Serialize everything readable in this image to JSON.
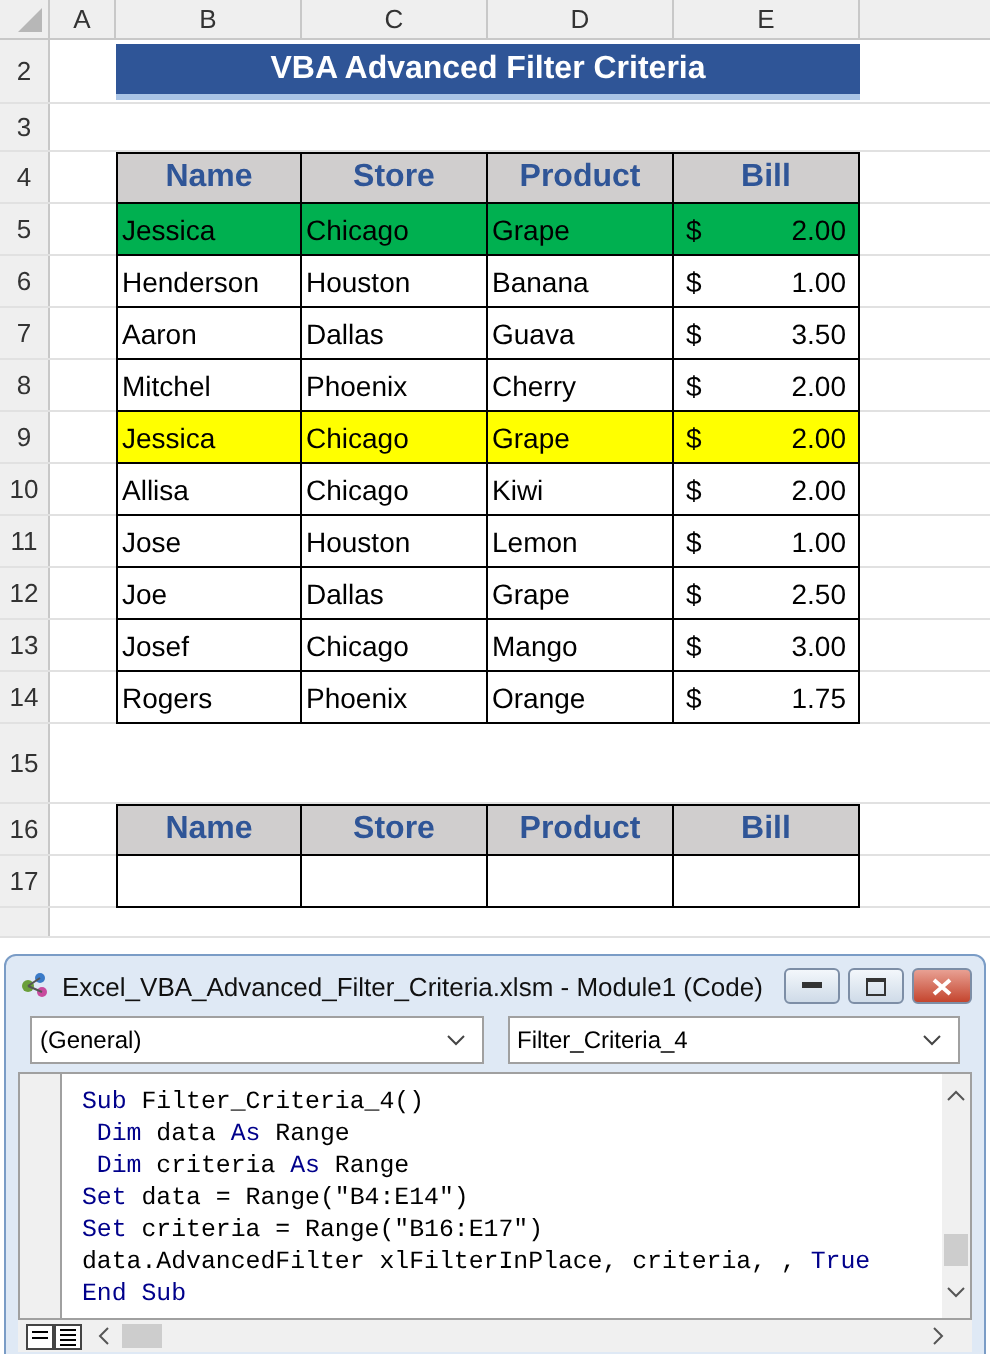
{
  "sheet": {
    "column_letters": [
      "A",
      "B",
      "C",
      "D",
      "E"
    ],
    "row_numbers": [
      "2",
      "3",
      "4",
      "5",
      "6",
      "7",
      "8",
      "9",
      "10",
      "11",
      "12",
      "13",
      "14",
      "15",
      "16",
      "17"
    ],
    "title": "VBA Advanced Filter Criteria",
    "table": {
      "columns": [
        "Name",
        "Store",
        "Product",
        "Bill"
      ],
      "rows": [
        {
          "name": "Jessica",
          "store": "Chicago",
          "product": "Grape",
          "currency": "$",
          "bill": "2.00",
          "color": "#00b050"
        },
        {
          "name": "Henderson",
          "store": "Houston",
          "product": "Banana",
          "currency": "$",
          "bill": "1.00"
        },
        {
          "name": "Aaron",
          "store": "Dallas",
          "product": "Guava",
          "currency": "$",
          "bill": "3.50"
        },
        {
          "name": "Mitchel",
          "store": "Phoenix",
          "product": "Cherry",
          "currency": "$",
          "bill": "2.00"
        },
        {
          "name": "Jessica",
          "store": "Chicago",
          "product": "Grape",
          "currency": "$",
          "bill": "2.00",
          "color": "#ffff00"
        },
        {
          "name": "Allisa",
          "store": "Chicago",
          "product": "Kiwi",
          "currency": "$",
          "bill": "2.00"
        },
        {
          "name": "Jose",
          "store": "Houston",
          "product": "Lemon",
          "currency": "$",
          "bill": "1.00"
        },
        {
          "name": "Joe",
          "store": "Dallas",
          "product": "Grape",
          "currency": "$",
          "bill": "2.50"
        },
        {
          "name": "Josef",
          "store": "Chicago",
          "product": "Mango",
          "currency": "$",
          "bill": "3.00"
        },
        {
          "name": "Rogers",
          "store": "Phoenix",
          "product": "Orange",
          "currency": "$",
          "bill": "1.75"
        }
      ]
    },
    "criteria": {
      "columns": [
        "Name",
        "Store",
        "Product",
        "Bill"
      ]
    }
  },
  "vba_window": {
    "title": "Excel_VBA_Advanced_Filter_Criteria.xlsm - Module1 (Code)",
    "object_dropdown": "(General)",
    "procedure_dropdown": "Filter_Criteria_4",
    "code_lines": [
      [
        {
          "text": "Sub",
          "kind": "keyword"
        },
        {
          "text": " Filter_Criteria_4()",
          "kind": "plain"
        }
      ],
      [
        {
          "text": " Dim",
          "kind": "keyword"
        },
        {
          "text": " data ",
          "kind": "plain"
        },
        {
          "text": "As",
          "kind": "keyword"
        },
        {
          "text": " Range",
          "kind": "plain"
        }
      ],
      [
        {
          "text": " Dim",
          "kind": "keyword"
        },
        {
          "text": " criteria ",
          "kind": "plain"
        },
        {
          "text": "As",
          "kind": "keyword"
        },
        {
          "text": " Range",
          "kind": "plain"
        }
      ],
      [
        {
          "text": "Set",
          "kind": "keyword"
        },
        {
          "text": " data = Range(\"B4:E14\")",
          "kind": "plain"
        }
      ],
      [
        {
          "text": "Set",
          "kind": "keyword"
        },
        {
          "text": " criteria = Range(\"B16:E17\")",
          "kind": "plain"
        }
      ],
      [
        {
          "text": "data.AdvancedFilter xlFilterInPlace, criteria, , ",
          "kind": "plain"
        },
        {
          "text": "True",
          "kind": "keyword"
        }
      ],
      [
        {
          "text": "End Sub",
          "kind": "keyword"
        }
      ]
    ]
  }
}
